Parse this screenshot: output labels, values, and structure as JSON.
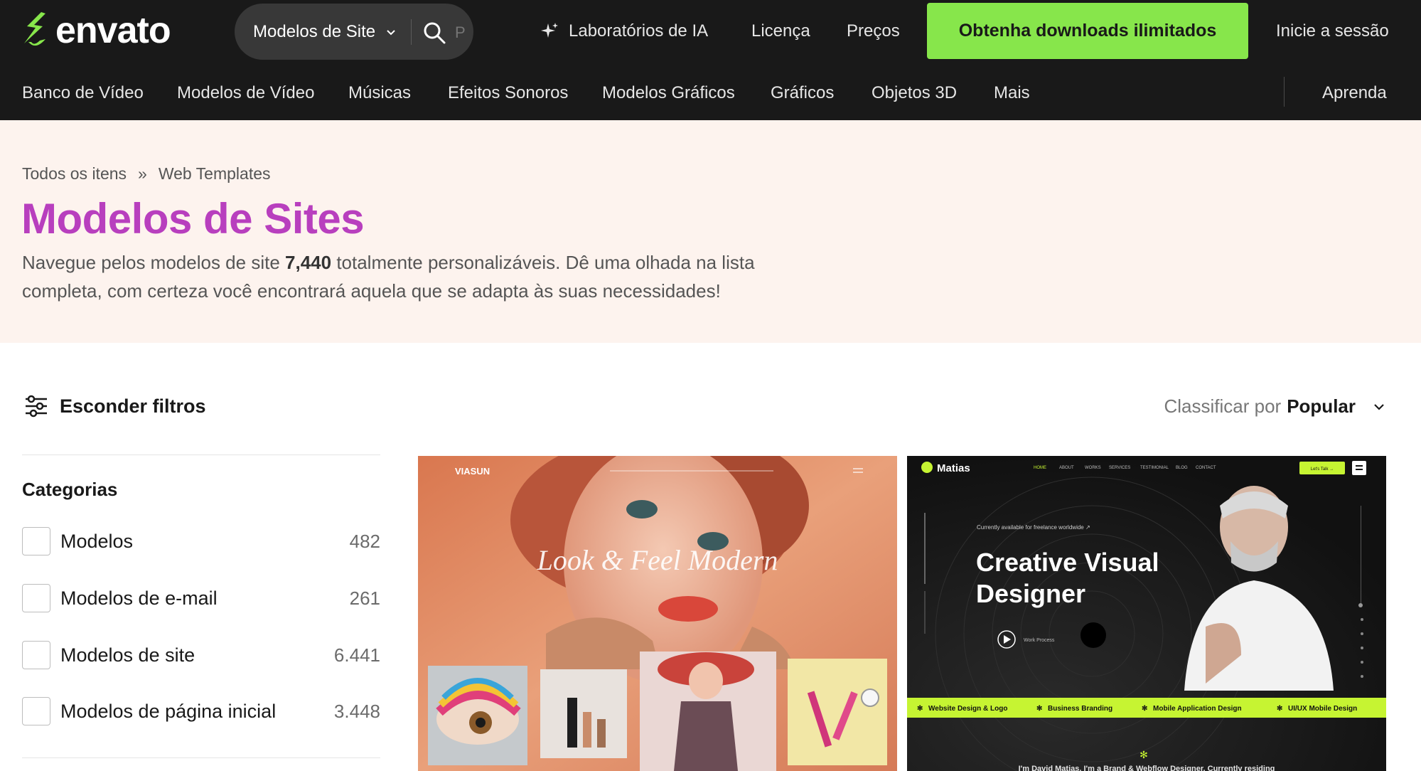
{
  "header": {
    "logo_text": "envato",
    "search": {
      "category": "Modelos de Site",
      "placeholder": "P"
    },
    "nav": [
      {
        "label": "Laboratórios de IA"
      },
      {
        "label": "Licença"
      },
      {
        "label": "Preços"
      }
    ],
    "cta_label": "Obtenha downloads ilimitados",
    "signin_label": "Inicie a sessão",
    "secondary_nav": [
      "Banco de Vídeo",
      "Modelos de Vídeo",
      "Músicas",
      "Efeitos Sonoros",
      "Modelos Gráficos",
      "Gráficos",
      "Objetos 3D",
      "Mais"
    ],
    "learn_label": "Aprenda"
  },
  "hero": {
    "breadcrumb": [
      "Todos os itens",
      "Web Templates"
    ],
    "breadcrumb_sep": "»",
    "title": "Modelos de Sites",
    "desc_prefix": "Navegue pelos modelos de site ",
    "desc_count": "7,440",
    "desc_suffix": " totalmente personalizáveis. Dê uma olhada na lista completa, com certeza você encontrará aquela que se adapta às suas necessidades!"
  },
  "filters": {
    "toggle_label": "Esconder filtros",
    "sort_prefix": "Classificar por",
    "sort_value": "Popular"
  },
  "categories": {
    "title": "Categorias",
    "items": [
      {
        "label": "Modelos",
        "count": "482"
      },
      {
        "label": "Modelos de e-mail",
        "count": "261"
      },
      {
        "label": "Modelos de site",
        "count": "6.441"
      },
      {
        "label": "Modelos de página inicial",
        "count": "3.448"
      }
    ]
  },
  "cards": [
    {
      "brand": "VIASUN",
      "headline": "Look & Feel Modern"
    },
    {
      "brand": "Matias",
      "tagline": "Currently available for freelance worldwide ↗",
      "headline_1": "Creative Visual",
      "headline_2": "Designer",
      "play_label": "Work Process",
      "button": "Let's Talk →",
      "nav": [
        "HOME",
        "ABOUT",
        "WORKS",
        "SERVICES",
        "TESTIMONIAL",
        "BLOG",
        "CONTACT"
      ],
      "services": [
        "Website Design & Logo",
        "Business Branding",
        "Mobile Application Design",
        "UI/UX Mobile Design"
      ],
      "footer_text": "I'm David Matias, I'm a Brand & Webflow Designer, Currently residing"
    }
  ],
  "colors": {
    "header_bg": "#191919",
    "cta_green": "#87e64b",
    "title_purple": "#b83fbe",
    "hero_bg": "#fdf3ee",
    "accent_lime": "#c6f432"
  }
}
